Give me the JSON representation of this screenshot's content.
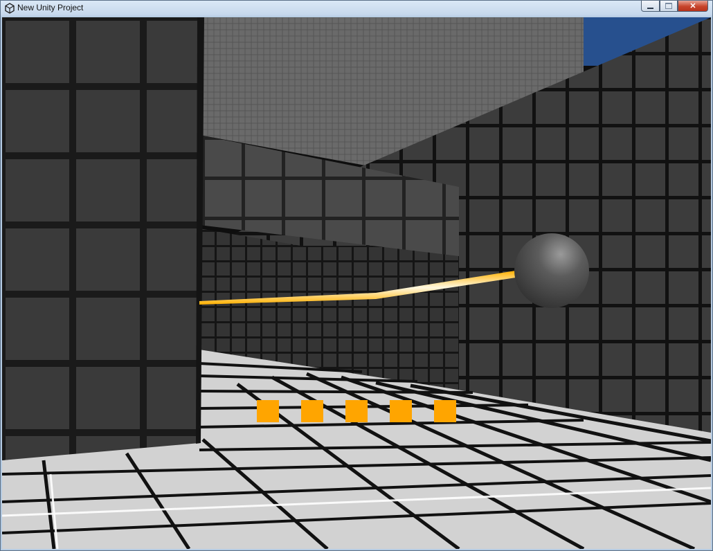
{
  "window": {
    "title": "New Unity Project",
    "controls": {
      "minimize": "minimize",
      "maximize": "maximize",
      "close": "close"
    }
  },
  "scene": {
    "sky_color": "#27508e",
    "wall_color": "#3a3a3a",
    "floor_color": "#cfcfcf",
    "laser_color": "#ffc23a",
    "sphere_color": "#4a4a4a"
  },
  "hud": {
    "indicator_color": "#ffa500",
    "indicator_count": 5
  }
}
